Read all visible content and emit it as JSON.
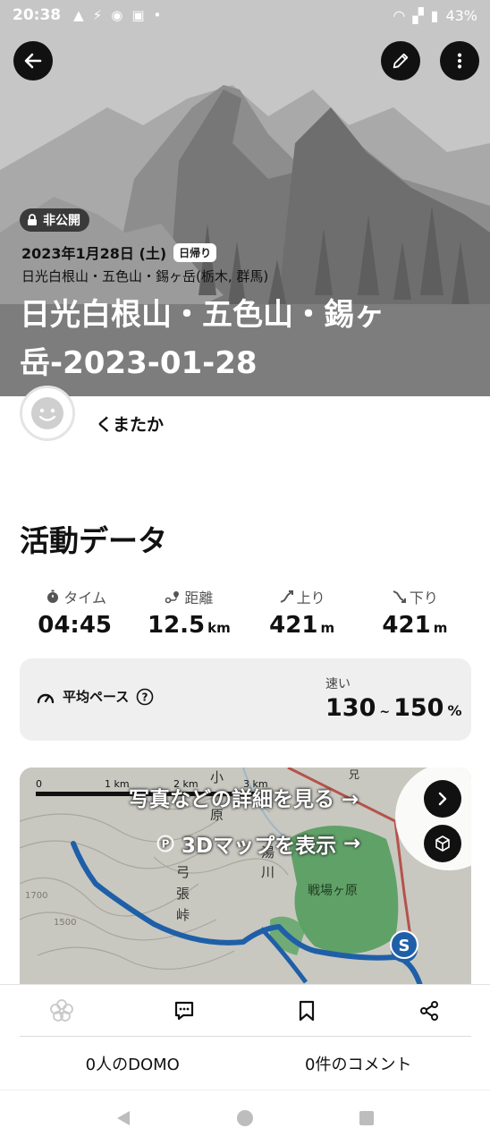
{
  "status_bar": {
    "time": "20:38",
    "battery": "43%",
    "icons": [
      "warning-icon",
      "usb-icon",
      "app-icon",
      "calendar-icon",
      "dot-icon",
      "wifi-icon",
      "signal-icon",
      "battery-icon"
    ]
  },
  "header": {
    "privacy_badge": "非公開",
    "date": "2023年1月28日 (土)",
    "day_badge": "日帰り",
    "area": "日光白根山・五色山・錫ヶ岳(栃木, 群馬)",
    "title": "日光白根山・五色山・錫ヶ岳-2023-01-28"
  },
  "user": {
    "name": "くまたか"
  },
  "activity": {
    "section_title": "活動データ",
    "stats": [
      {
        "label": "タイム",
        "value": "04:45",
        "unit": ""
      },
      {
        "label": "距離",
        "value": "12.5",
        "unit": "km"
      },
      {
        "label": "上り",
        "value": "421",
        "unit": "m"
      },
      {
        "label": "下り",
        "value": "421",
        "unit": "m"
      }
    ],
    "pace": {
      "label": "平均ペース",
      "speed_label": "速い",
      "min": "130",
      "tilde": "~",
      "max": "150",
      "unit": "%"
    }
  },
  "map": {
    "link_details": "写真などの詳細を見る",
    "link_3d": "3Dマップを表示",
    "arrow": "→",
    "scale_labels": [
      "0",
      "1 km",
      "2 km",
      "3 km"
    ],
    "place_labels": [
      "小",
      "兄",
      "原",
      "湯",
      "川",
      "弓",
      "張",
      "峠",
      "戦場ヶ原",
      "1700",
      "1500"
    ],
    "start_marker": "S"
  },
  "counts": {
    "domo": "0人のDOMO",
    "comments": "0件のコメント"
  },
  "colors": {
    "route": "#1f5fa8",
    "start_marker": "#1f5fa8",
    "hero_bg": "#bcbcbc",
    "map_green": "#4e9a58"
  }
}
